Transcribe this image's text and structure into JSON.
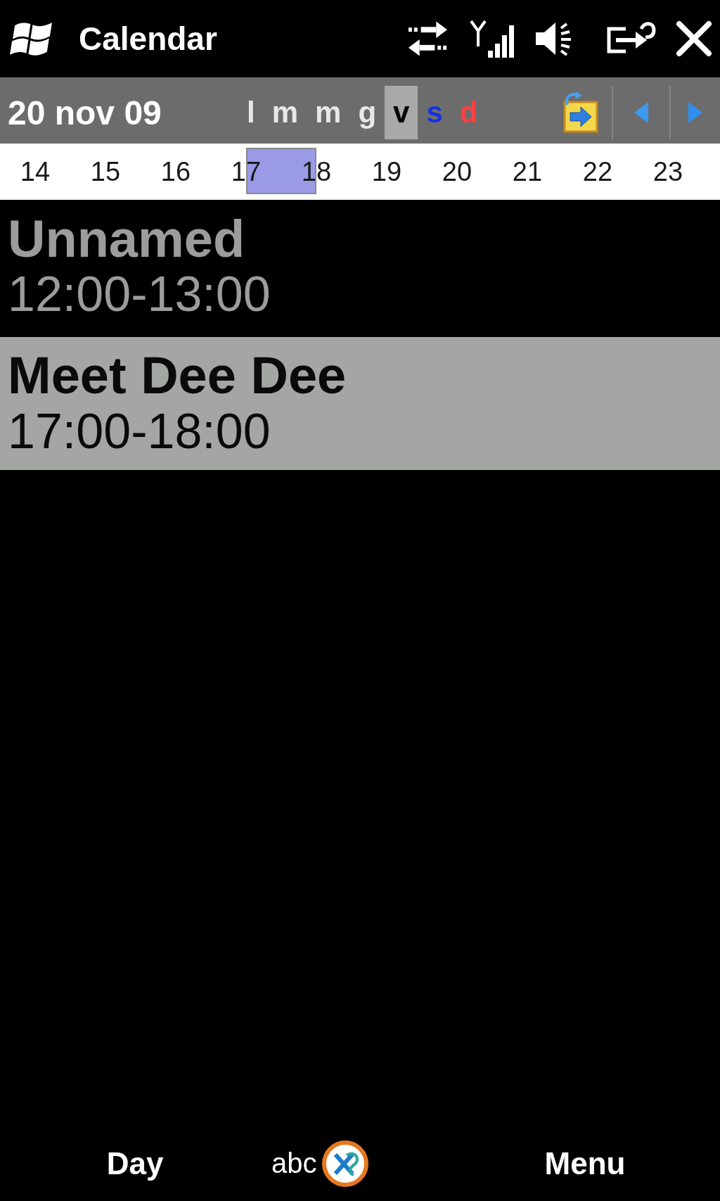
{
  "title_bar": {
    "title": "Calendar"
  },
  "date_bar": {
    "date": "20 nov 09",
    "weekdays": [
      {
        "label": "l",
        "selected": false,
        "kind": "weekday"
      },
      {
        "label": "m",
        "selected": false,
        "kind": "weekday"
      },
      {
        "label": "m",
        "selected": false,
        "kind": "weekday"
      },
      {
        "label": "g",
        "selected": false,
        "kind": "weekday"
      },
      {
        "label": "v",
        "selected": true,
        "kind": "weekday"
      },
      {
        "label": "s",
        "selected": false,
        "kind": "saturday"
      },
      {
        "label": "d",
        "selected": false,
        "kind": "sunday"
      }
    ]
  },
  "hour_strip": {
    "hours": [
      {
        "label": "14",
        "selected": false
      },
      {
        "label": "15",
        "selected": false
      },
      {
        "label": "16",
        "selected": false
      },
      {
        "label": "17",
        "selected": true
      },
      {
        "label": "18",
        "selected": false
      },
      {
        "label": "19",
        "selected": false
      },
      {
        "label": "20",
        "selected": false
      },
      {
        "label": "21",
        "selected": false
      },
      {
        "label": "22",
        "selected": false
      },
      {
        "label": "23",
        "selected": false
      }
    ]
  },
  "appointments": [
    {
      "title": "Unnamed",
      "time": "12:00-13:00",
      "selected": false
    },
    {
      "title": "Meet Dee Dee",
      "time": "17:00-18:00",
      "selected": true
    }
  ],
  "softkeys": {
    "left": "Day",
    "input_mode": "abc",
    "right": "Menu"
  }
}
